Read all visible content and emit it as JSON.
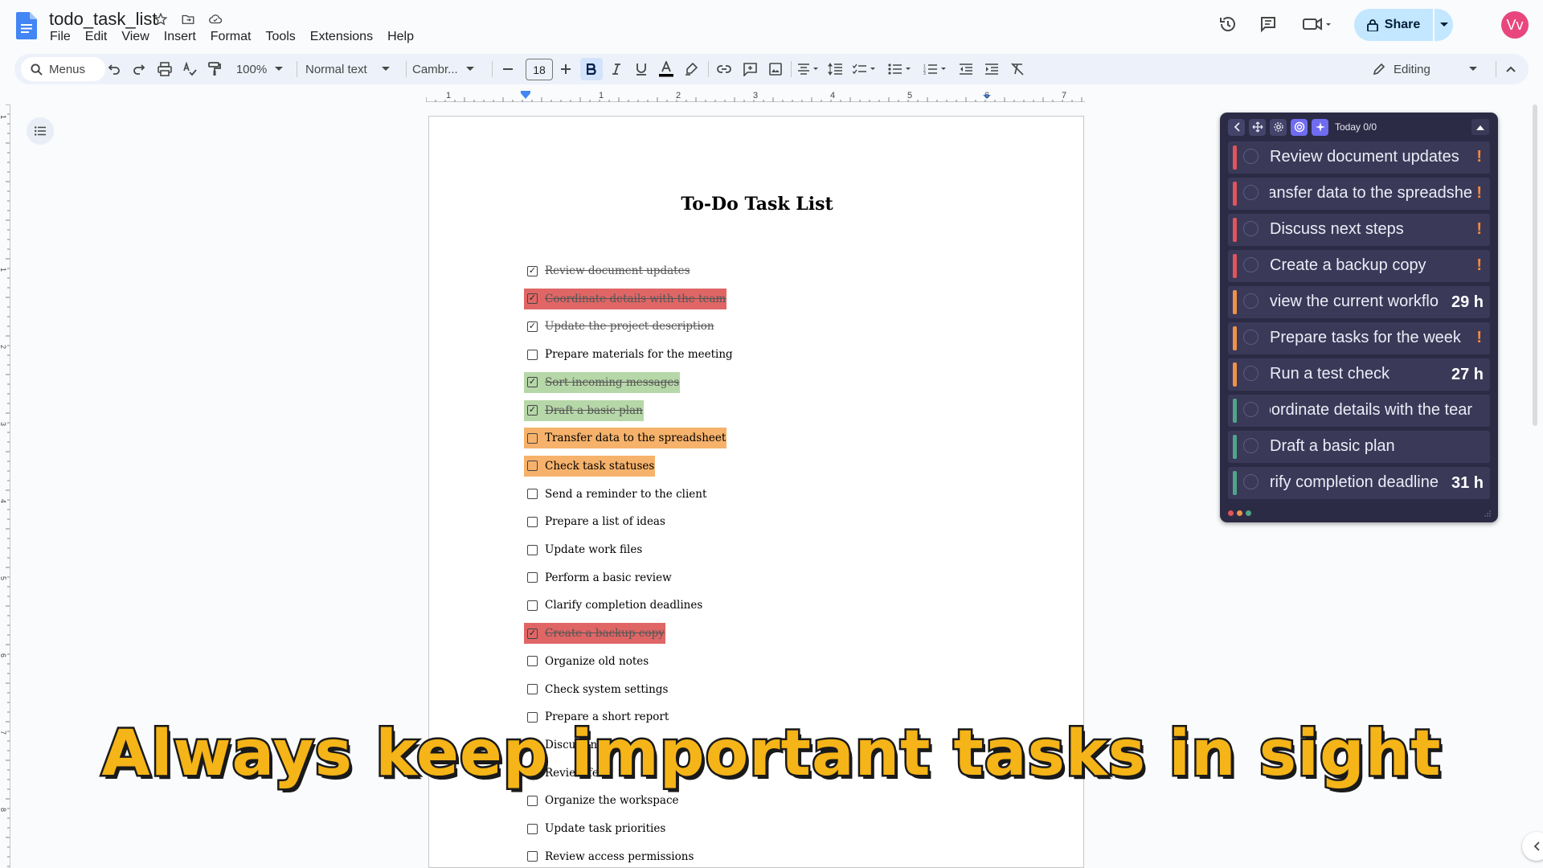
{
  "app": {
    "doc_title": "todo_task_list"
  },
  "menubar": [
    "File",
    "Edit",
    "View",
    "Insert",
    "Format",
    "Tools",
    "Extensions",
    "Help"
  ],
  "header": {
    "share_label": "Share",
    "avatar_initials": "Vv"
  },
  "toolbar": {
    "menus_label": "Menus",
    "zoom": "100%",
    "style": "Normal text",
    "font": "Cambr...",
    "font_size": "18",
    "mode": "Editing"
  },
  "ruler": {
    "labels": [
      "1",
      "1",
      "2",
      "3",
      "4",
      "5",
      "6",
      "7"
    ],
    "vlabels": [
      "1",
      "1",
      "2",
      "3",
      "4",
      "5",
      "6",
      "7",
      "8"
    ]
  },
  "document": {
    "heading": "To-Do Task List",
    "tasks": [
      {
        "text": "Review document updates",
        "checked": true,
        "highlight": ""
      },
      {
        "text": "Coordinate details with the team",
        "checked": true,
        "highlight": "#e06666"
      },
      {
        "text": "Update the project description",
        "checked": true,
        "highlight": ""
      },
      {
        "text": "Prepare materials for the meeting",
        "checked": false,
        "highlight": ""
      },
      {
        "text": "Sort incoming messages",
        "checked": true,
        "highlight": "#b6d7a8"
      },
      {
        "text": "Draft a basic plan",
        "checked": true,
        "highlight": "#b6d7a8"
      },
      {
        "text": "Transfer data to the spreadsheet",
        "checked": false,
        "highlight": "#f6b26b"
      },
      {
        "text": "Check task statuses",
        "checked": false,
        "highlight": "#f6b26b"
      },
      {
        "text": "Send a reminder to the client",
        "checked": false,
        "highlight": ""
      },
      {
        "text": "Prepare a list of ideas",
        "checked": false,
        "highlight": ""
      },
      {
        "text": "Update work files",
        "checked": false,
        "highlight": ""
      },
      {
        "text": "Perform a basic review",
        "checked": false,
        "highlight": ""
      },
      {
        "text": "Clarify completion deadlines",
        "checked": false,
        "highlight": ""
      },
      {
        "text": "Create a backup copy",
        "checked": true,
        "highlight": "#e06666"
      },
      {
        "text": "Organize old notes",
        "checked": false,
        "highlight": ""
      },
      {
        "text": "Check system settings",
        "checked": false,
        "highlight": ""
      },
      {
        "text": "Prepare a short report",
        "checked": false,
        "highlight": ""
      },
      {
        "text": "Discuss next",
        "checked": false,
        "highlight": ""
      },
      {
        "text": "Review feed",
        "checked": false,
        "highlight": ""
      },
      {
        "text": "Organize the workspace",
        "checked": false,
        "highlight": ""
      },
      {
        "text": "Update task priorities",
        "checked": false,
        "highlight": ""
      },
      {
        "text": "Review access permissions",
        "checked": false,
        "highlight": ""
      }
    ]
  },
  "widget": {
    "today_label": "Today 0/0",
    "items": [
      {
        "text": "Review document updates",
        "bar": "#e0555a",
        "badge": "!",
        "cut": false
      },
      {
        "text": "ansfer data to the spreadshe",
        "bar": "#e0555a",
        "badge": "!",
        "cut": true
      },
      {
        "text": "Discuss next steps",
        "bar": "#e0555a",
        "badge": "!",
        "cut": false
      },
      {
        "text": "Create a backup copy",
        "bar": "#e0555a",
        "badge": "!",
        "cut": false
      },
      {
        "text": "eview the current workflo",
        "bar": "#f0914a",
        "hours": "29 h",
        "cut": true
      },
      {
        "text": "Prepare tasks for the week",
        "bar": "#f0914a",
        "badge": "!",
        "cut": false
      },
      {
        "text": "Run a test check",
        "bar": "#f0914a",
        "hours": "27 h",
        "cut": false
      },
      {
        "text": "oordinate details with the tear",
        "bar": "#4fa58a",
        "cut": true
      },
      {
        "text": "Draft a basic plan",
        "bar": "#4fa58a",
        "cut": false
      },
      {
        "text": "arify completion deadline",
        "bar": "#4fa58a",
        "hours": "31 h",
        "cut": true
      }
    ]
  },
  "caption": "Always keep important tasks in sight"
}
